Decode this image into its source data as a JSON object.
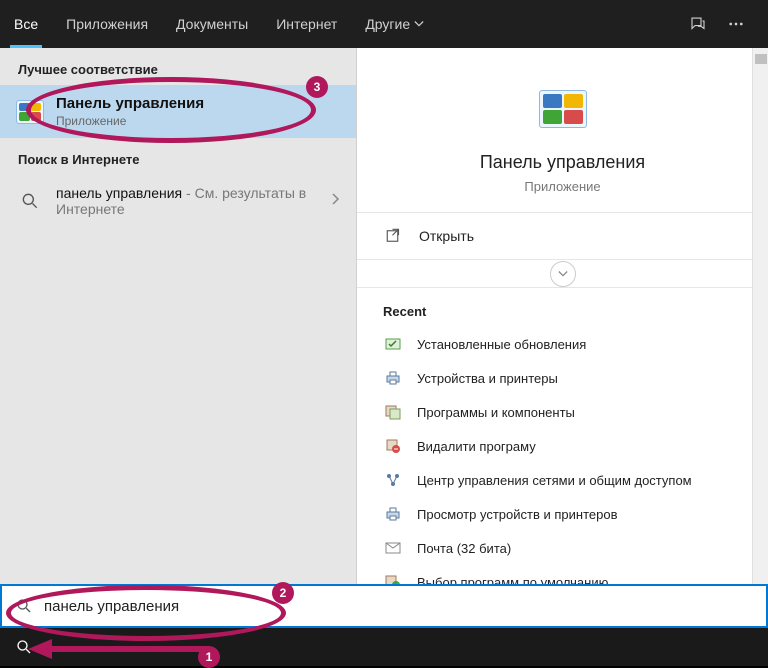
{
  "header": {
    "tabs": [
      "Все",
      "Приложения",
      "Документы",
      "Интернет",
      "Другие"
    ],
    "active_tab": 0
  },
  "left": {
    "best_match_hdr": "Лучшее соответствие",
    "best_match": {
      "title": "Панель управления",
      "sub": "Приложение"
    },
    "web_hdr": "Поиск в Интернете",
    "web": {
      "query": "панель управления",
      "suffix": " - См. результаты в Интернете"
    }
  },
  "preview": {
    "title": "Панель управления",
    "sub": "Приложение",
    "open_label": "Открыть",
    "recent_hdr": "Recent",
    "recent": [
      "Установленные обновления",
      "Устройства и принтеры",
      "Программы и компоненты",
      "Видалити програму",
      "Центр управления сетями и общим доступом",
      "Просмотр устройств и принтеров",
      "Почта (32 бита)",
      "Выбор программ по умолчанию"
    ]
  },
  "search": {
    "value": "панель управления"
  },
  "annotations": {
    "n1": "1",
    "n2": "2",
    "n3": "3"
  }
}
